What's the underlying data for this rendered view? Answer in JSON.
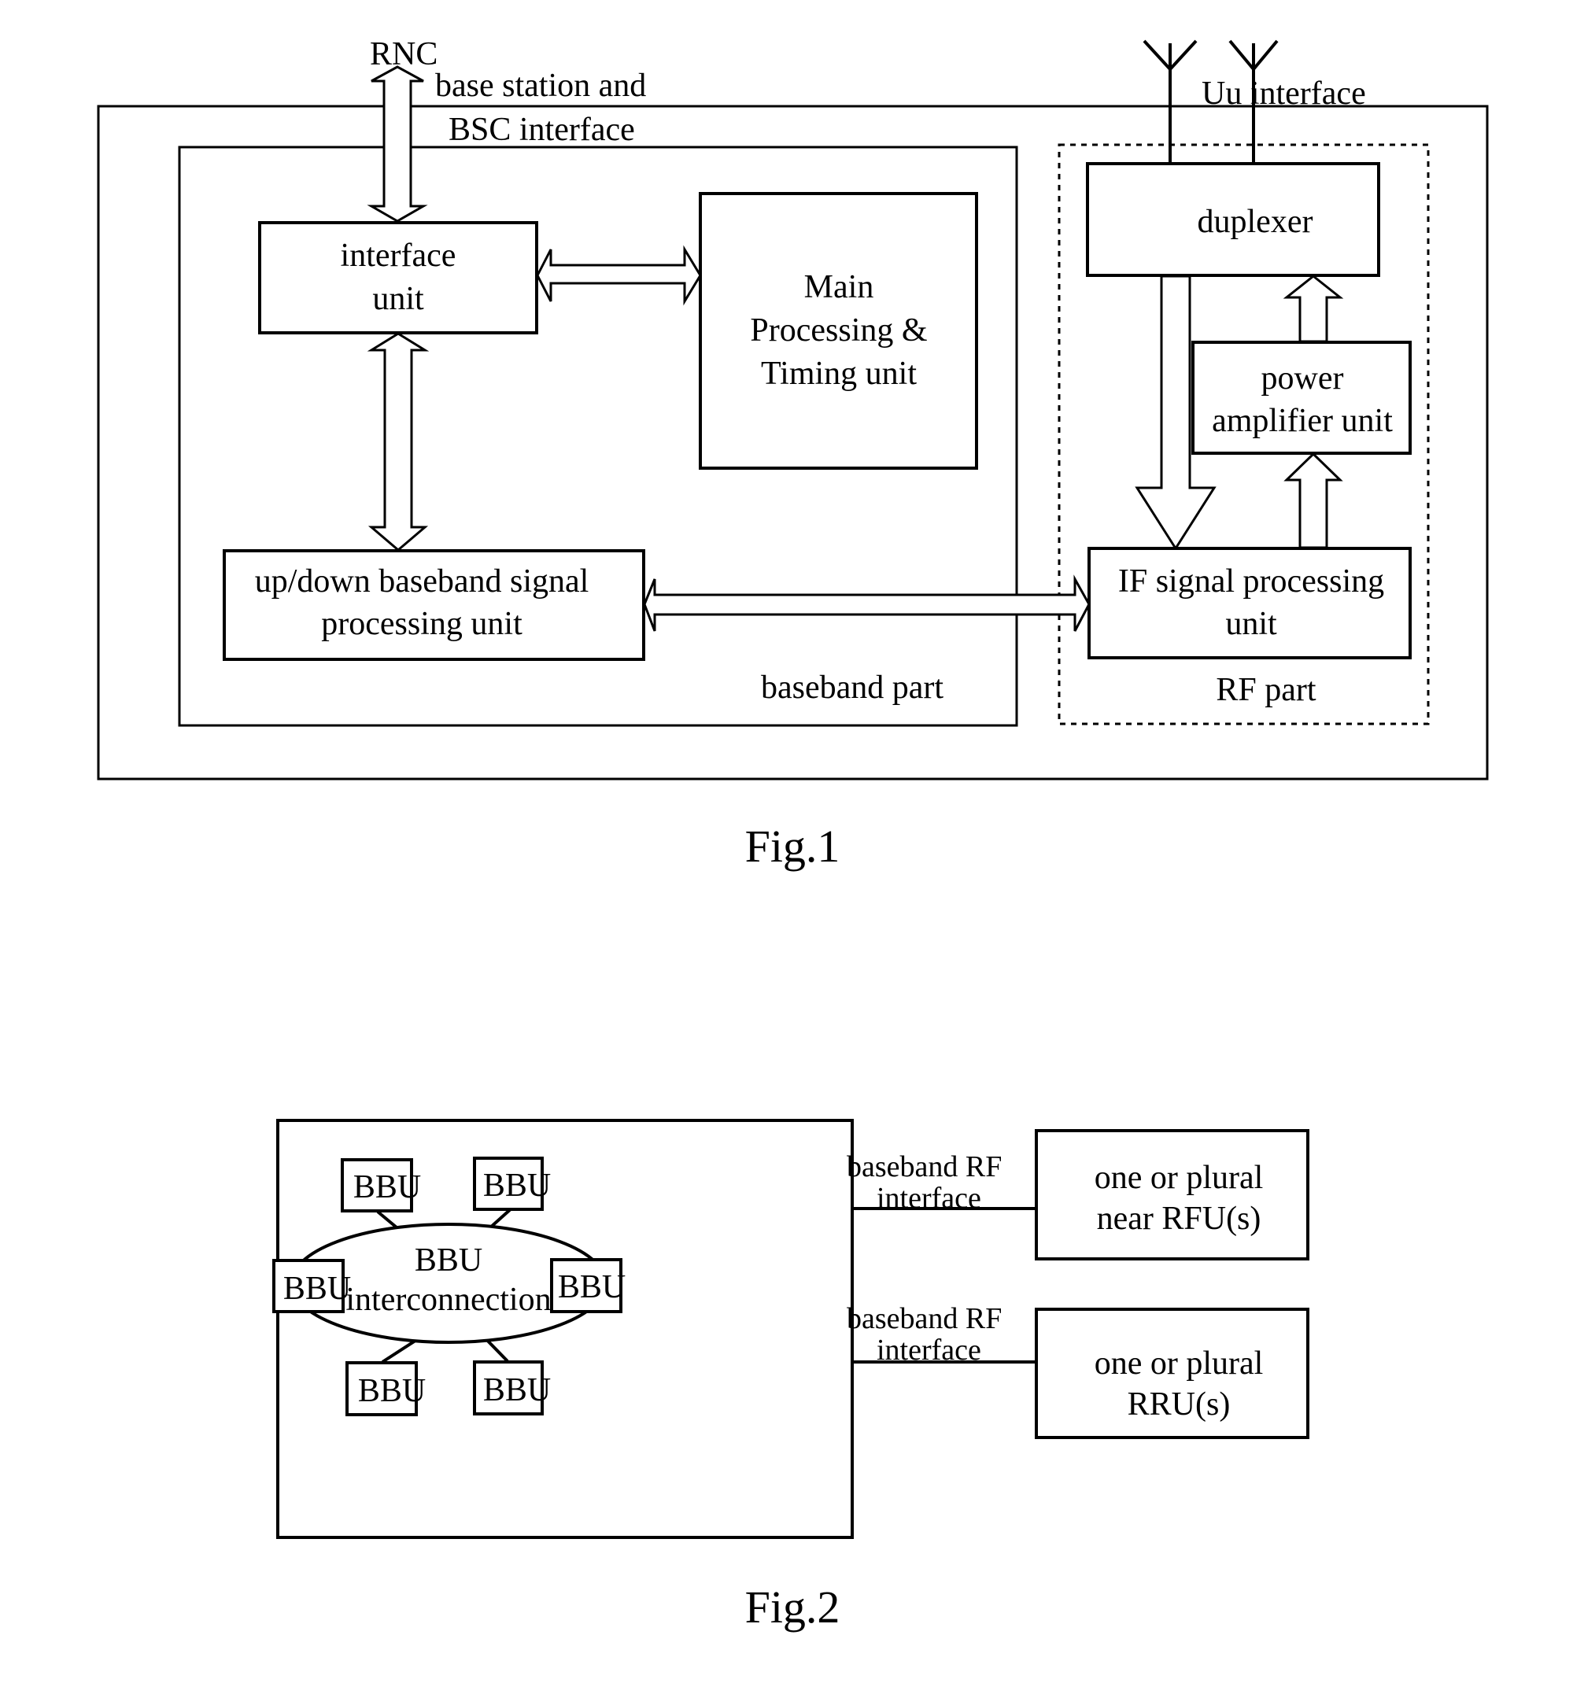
{
  "figure1": {
    "caption": "Fig.1",
    "top_labels": {
      "rnc": "RNC",
      "bsc_interface_line1": "base station and",
      "bsc_interface_line2": "BSC interface",
      "uu_interface": "Uu interface"
    },
    "blocks": {
      "interface_unit": [
        "interface",
        "unit"
      ],
      "main_processing": [
        "Main",
        "Processing &",
        "Timing unit"
      ],
      "baseband_signal": [
        "up/down baseband signal",
        "processing unit"
      ],
      "duplexer": [
        "duplexer"
      ],
      "power_amplifier": [
        "power",
        "amplifier unit"
      ],
      "if_signal": [
        "IF signal processing",
        "unit"
      ]
    },
    "regions": {
      "baseband_part": "baseband part",
      "rf_part": "RF part"
    }
  },
  "figure2": {
    "caption": "Fig.2",
    "center_node": [
      "BBU",
      "interconnection"
    ],
    "bbu_label": "BBU",
    "bbu_count": 6,
    "interfaces": [
      {
        "line1": "baseband RF",
        "line2": "interface",
        "target": [
          "one or plural",
          "near RFU(s)"
        ]
      },
      {
        "line1": "baseband RF",
        "line2": "interface",
        "target": [
          "one or plural",
          "RRU(s)"
        ]
      }
    ]
  }
}
